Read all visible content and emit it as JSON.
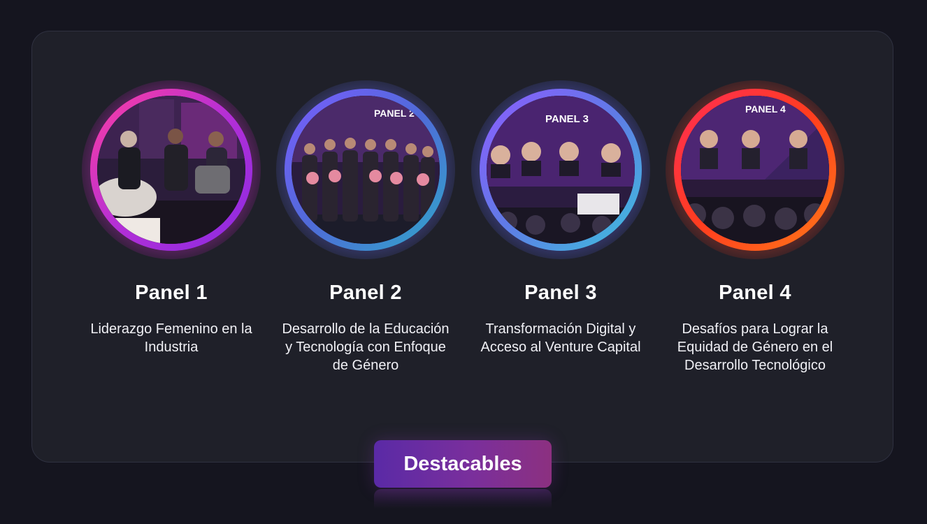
{
  "panels": [
    {
      "title": "Panel 1",
      "description": "Liderazgo Femenino en la Industria",
      "ring_colors": [
        "#ff3ea0",
        "#b42fd6",
        "#8a2be2"
      ]
    },
    {
      "title": "Panel 2",
      "description": "Desarrollo de la Educación y Tecnología con Enfoque de Género",
      "ring_colors": [
        "#7b5cff",
        "#4f6bd8",
        "#2fa8c9"
      ]
    },
    {
      "title": "Panel 3",
      "description": "Transformación Digital y Acceso al Venture Capital",
      "ring_colors": [
        "#8e5bff",
        "#5f7be6",
        "#3cc3dc"
      ]
    },
    {
      "title": "Panel 4",
      "description": "Desafíos para Lograr la Equidad de Género en el Desarrollo Tecnológico",
      "ring_colors": [
        "#ff2d55",
        "#ff3d1f",
        "#ff7a18"
      ]
    }
  ],
  "photo_labels": {
    "panel2_banner": "PANEL 2",
    "panel3_banner": "PANEL 3",
    "panel4_banner": "PANEL 4"
  },
  "cta": {
    "label": "Destacables",
    "gradient": [
      "#5a2aa6",
      "#8c3080"
    ]
  },
  "colors": {
    "background": "#15151f",
    "card": "#1f2029",
    "text": "#ffffff"
  }
}
